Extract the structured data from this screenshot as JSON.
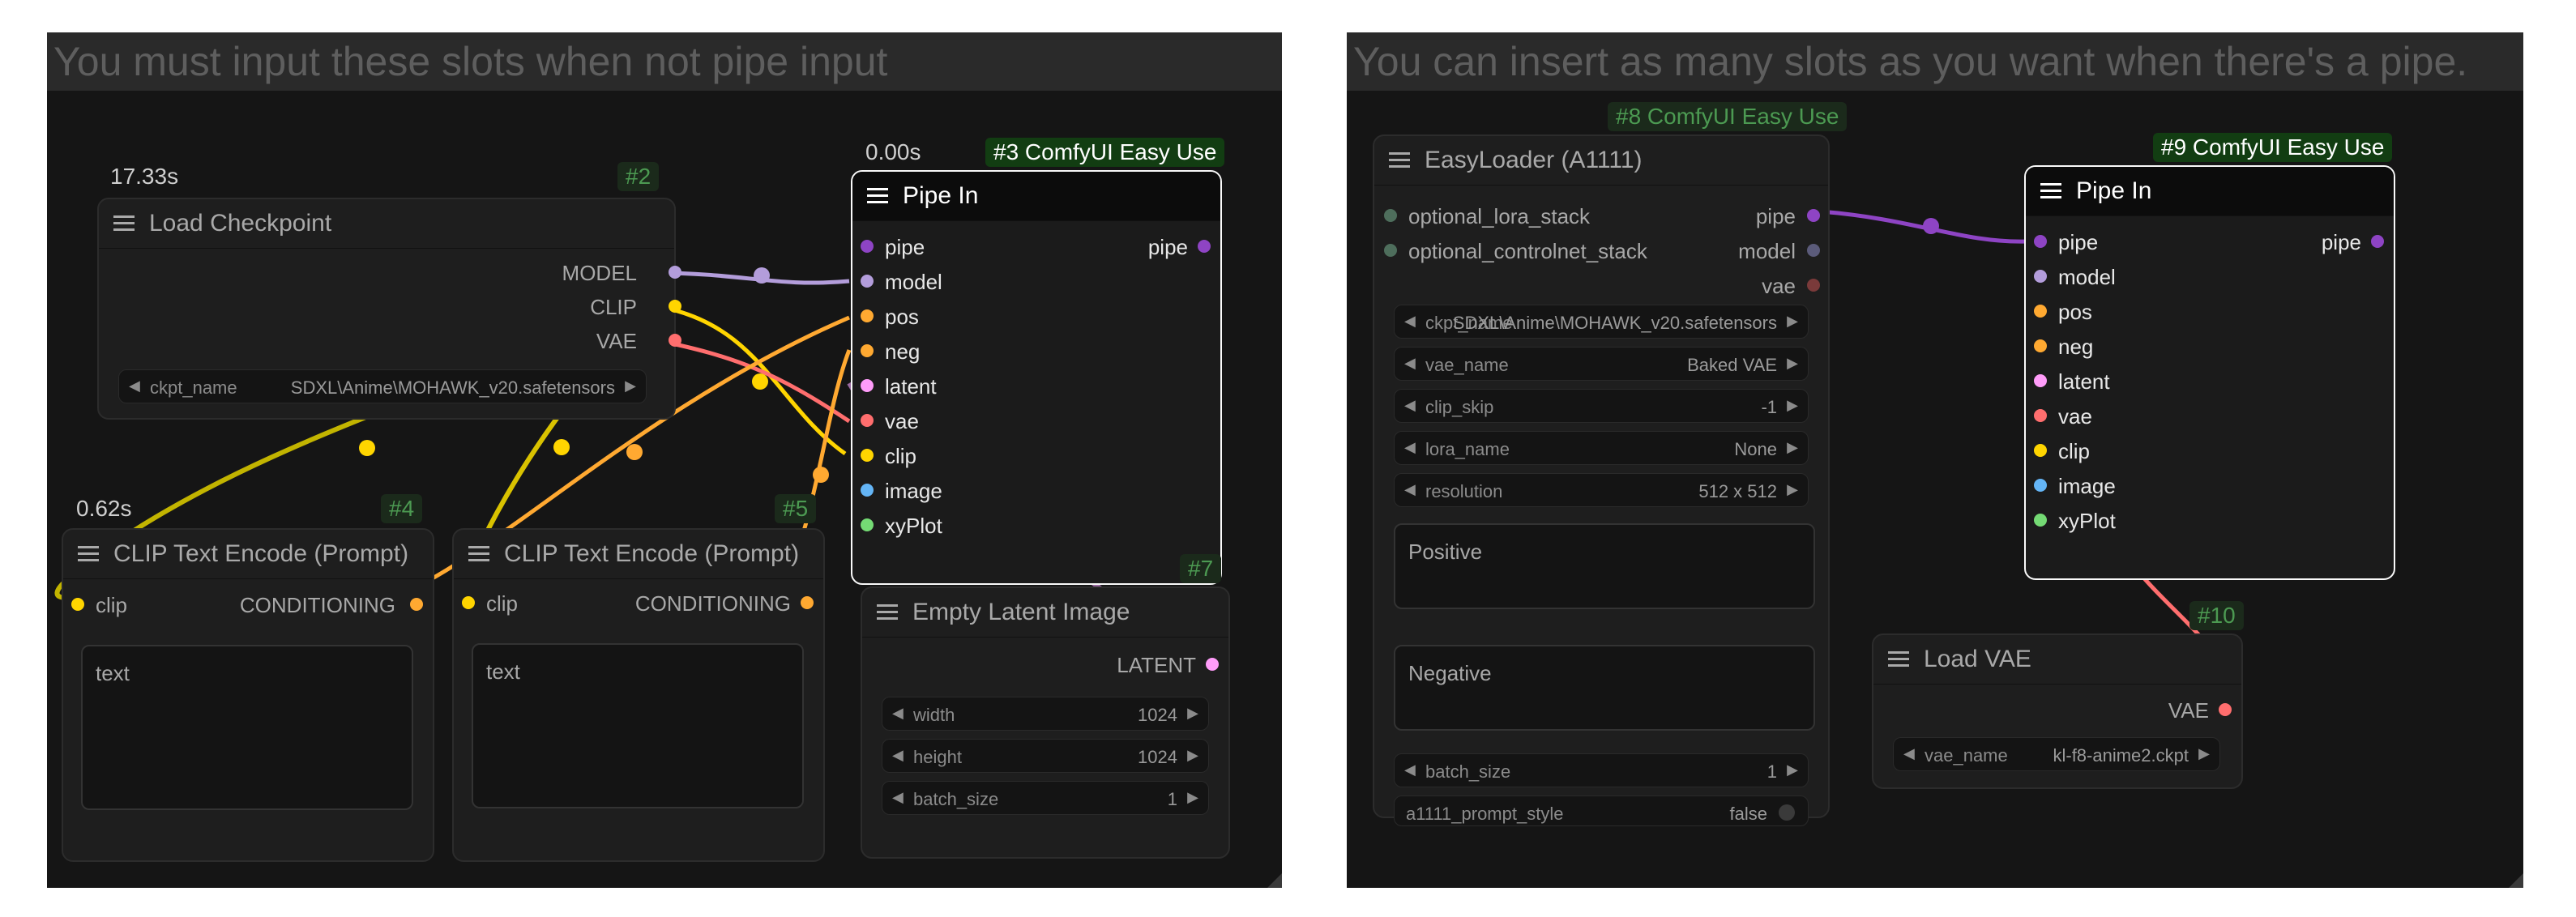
{
  "panels": {
    "left": {
      "group_title": "You must input these slots when not pipe input"
    },
    "right": {
      "group_title": "You can insert as many slots as you want when there's a pipe."
    }
  },
  "nodes": {
    "load_checkpoint": {
      "time": "17.33s",
      "id": "#2",
      "title": "Load Checkpoint",
      "outputs": [
        "MODEL",
        "CLIP",
        "VAE"
      ],
      "widget": {
        "label": "ckpt_name",
        "value": "SDXL\\Anime\\MOHAWK_v20.safetensors"
      }
    },
    "pipe_in_left": {
      "time": "0.00s",
      "id": "#3 ComfyUI Easy Use",
      "title": "Pipe In",
      "inputs": [
        "pipe",
        "model",
        "pos",
        "neg",
        "latent",
        "vae",
        "clip",
        "image",
        "xyPlot"
      ],
      "output": "pipe"
    },
    "clip_encode_1": {
      "time": "0.62s",
      "id": "#4",
      "title": "CLIP Text Encode (Prompt)",
      "input": "clip",
      "output": "CONDITIONING",
      "text_placeholder": "text"
    },
    "clip_encode_2": {
      "id": "#5",
      "title": "CLIP Text Encode (Prompt)",
      "input": "clip",
      "output": "CONDITIONING",
      "text_placeholder": "text"
    },
    "empty_latent": {
      "id": "#7",
      "title": "Empty Latent Image",
      "output": "LATENT",
      "widgets": [
        {
          "label": "width",
          "value": "1024"
        },
        {
          "label": "height",
          "value": "1024"
        },
        {
          "label": "batch_size",
          "value": "1"
        }
      ]
    },
    "easy_loader": {
      "id": "#8 ComfyUI Easy Use",
      "title": "EasyLoader (A1111)",
      "inputs": [
        "optional_lora_stack",
        "optional_controlnet_stack"
      ],
      "outputs": [
        "pipe",
        "model",
        "vae"
      ],
      "widgets": [
        {
          "label": "ckpt_name",
          "value": "SDXL\\Anime\\MOHAWK_v20.safetensors"
        },
        {
          "label": "vae_name",
          "value": "Baked VAE"
        },
        {
          "label": "clip_skip",
          "value": "-1"
        },
        {
          "label": "lora_name",
          "value": "None"
        },
        {
          "label": "resolution",
          "value": "512 x 512"
        }
      ],
      "positive_placeholder": "Positive",
      "negative_placeholder": "Negative",
      "batch": {
        "label": "batch_size",
        "value": "1"
      },
      "style": {
        "label": "a1111_prompt_style",
        "value": "false"
      }
    },
    "pipe_in_right": {
      "id": "#9 ComfyUI Easy Use",
      "title": "Pipe In",
      "inputs": [
        "pipe",
        "model",
        "pos",
        "neg",
        "latent",
        "vae",
        "clip",
        "image",
        "xyPlot"
      ],
      "output": "pipe"
    },
    "load_vae": {
      "id": "#10",
      "title": "Load VAE",
      "output": "VAE",
      "widget": {
        "label": "vae_name",
        "value": "kl-f8-anime2.ckpt"
      }
    }
  },
  "colors": {
    "pipe": "#8e44c4",
    "model": "#b39ddb",
    "pos": "#ffa931",
    "neg": "#ffa931",
    "latent": "#ff9cf9",
    "vae": "#ff6e6e",
    "clip": "#ffd500",
    "image": "#64b5f6",
    "xyPlot": "#74da74",
    "generic": "#6e8a7a"
  },
  "icons": [
    "hamburger-menu-icon",
    "arrow-left-icon",
    "arrow-right-icon",
    "toggle-icon",
    "resize-handle-icon"
  ]
}
